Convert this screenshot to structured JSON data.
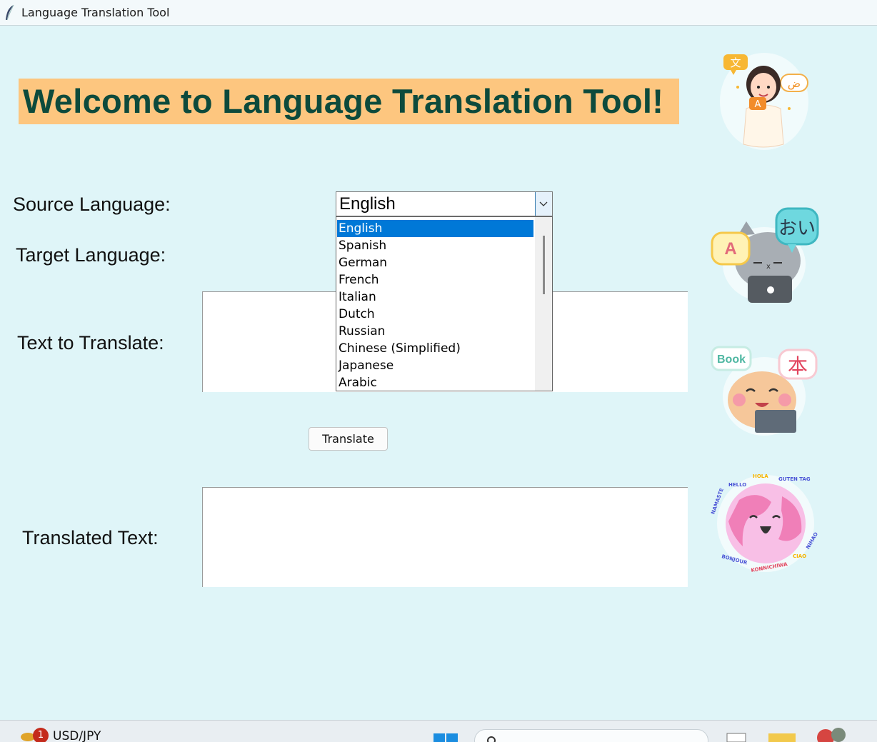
{
  "window": {
    "title": "Language Translation Tool",
    "icon": "feather-icon"
  },
  "header": {
    "welcome": "Welcome to Language Translation Tool!"
  },
  "form": {
    "source_label": "Source Language:",
    "target_label": "Target Language:",
    "text_label": "Text to Translate:",
    "translated_label": "Translated Text:",
    "source_value": "English",
    "text_value": "",
    "translated_value": "",
    "translate_button": "Translate"
  },
  "dropdown": {
    "options": [
      "English",
      "Spanish",
      "German",
      "French",
      "Italian",
      "Dutch",
      "Russian",
      "Chinese (Simplified)",
      "Japanese",
      "Arabic"
    ],
    "selected": "English"
  },
  "stickers": {
    "cat_bubble_left": "A",
    "cat_bubble_right": "おい",
    "hamster_bubble_left": "Book",
    "hamster_bubble_right": "本",
    "girl_bubble_left": "文",
    "girl_bubble_right": "ض",
    "girl_card": "A",
    "globe_words": [
      "HELLO",
      "HOLA",
      "GUTEN TAG",
      "NAMASTE",
      "NIHAO",
      "CIAO",
      "BONJOUR",
      "KONNICHIWA"
    ]
  },
  "taskbar": {
    "ticker": "USD/JPY",
    "badge": "1"
  },
  "colors": {
    "background": "#dff5f8",
    "banner": "#fdc67f",
    "heading": "#0d4a3c",
    "selection": "#0078d7"
  }
}
